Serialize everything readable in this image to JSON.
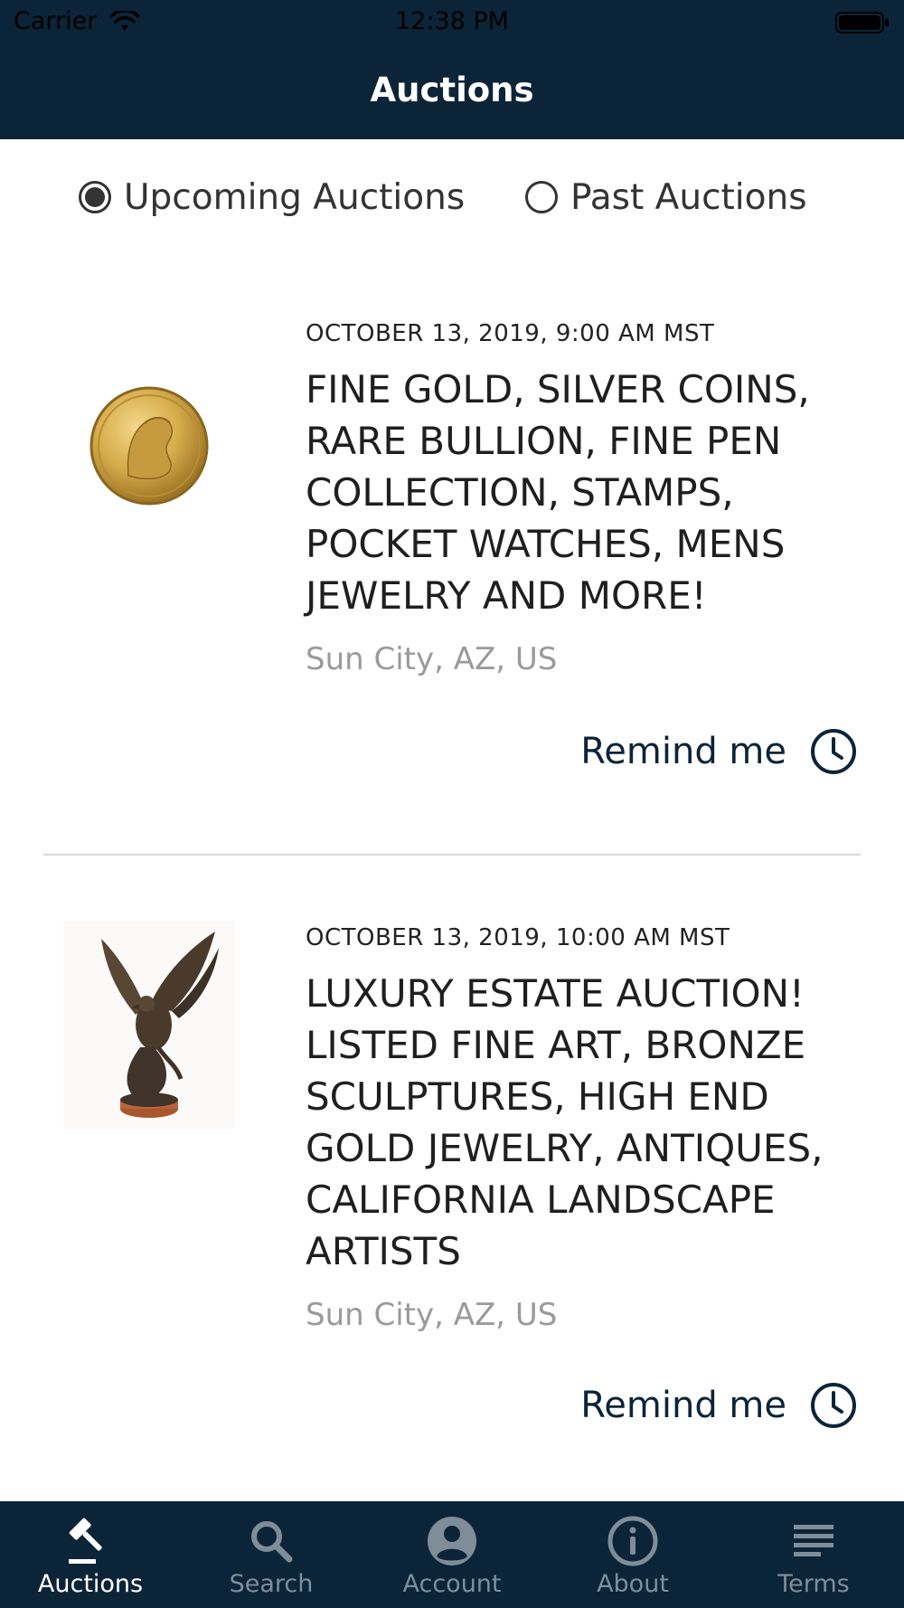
{
  "status_bar": {
    "carrier": "Carrier",
    "time": "12:38 PM"
  },
  "nav": {
    "title": "Auctions"
  },
  "filter": {
    "options": [
      {
        "label": "Upcoming Auctions",
        "selected": true
      },
      {
        "label": "Past Auctions",
        "selected": false
      }
    ]
  },
  "auctions": [
    {
      "date": "OCTOBER 13, 2019, 9:00 AM MST",
      "title": "FINE GOLD, SILVER COINS, RARE BULLION, FINE PEN COLLECTION, STAMPS, POCKET WATCHES, MENS JEWELRY AND MORE!",
      "location": "Sun City, AZ, US",
      "remind_label": "Remind me",
      "image_icon": "gold-coin-icon"
    },
    {
      "date": "OCTOBER 13, 2019, 10:00 AM MST",
      "title": "LUXURY ESTATE AUCTION! LISTED FINE ART, BRONZE SCULPTURES, HIGH END GOLD JEWELRY, ANTIQUES, CALIFORNIA LANDSCAPE ARTISTS",
      "location": "Sun City, AZ, US",
      "remind_label": "Remind me",
      "image_icon": "bronze-eagle-icon"
    }
  ],
  "tabbar": {
    "tabs": [
      {
        "label": "Auctions",
        "icon": "gavel-icon",
        "active": true
      },
      {
        "label": "Search",
        "icon": "search-icon",
        "active": false
      },
      {
        "label": "Account",
        "icon": "account-icon",
        "active": false
      },
      {
        "label": "About",
        "icon": "info-icon",
        "active": false
      },
      {
        "label": "Terms",
        "icon": "list-icon",
        "active": false
      }
    ]
  },
  "colors": {
    "brand_navy": "#0c2438",
    "location_gray": "#9a9a9a",
    "tab_inactive": "#7f8d99"
  }
}
